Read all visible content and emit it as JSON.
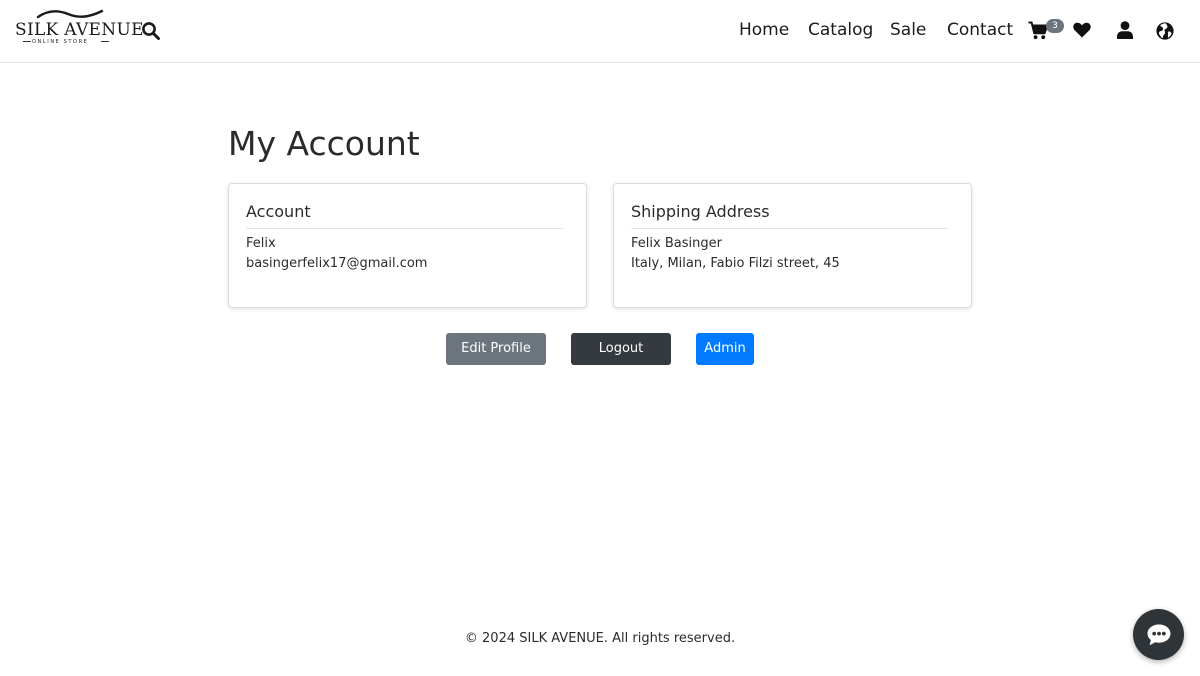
{
  "header": {
    "logo": {
      "brand": "SILK AVENUE",
      "tagline": "ONLINE STORE"
    },
    "search_icon": "search-icon",
    "nav": [
      {
        "label": "Home"
      },
      {
        "label": "Catalog"
      },
      {
        "label": "Sale"
      },
      {
        "label": "Contact"
      }
    ],
    "cart": {
      "icon": "cart-icon",
      "count": "3"
    },
    "wishlist_icon": "heart-icon",
    "account_icon": "user-icon",
    "language_icon": "globe-icon"
  },
  "main": {
    "title": "My Account",
    "account_card": {
      "title": "Account",
      "name": "Felix",
      "email": "basingerfelix17@gmail.com"
    },
    "shipping_card": {
      "title": "Shipping Address",
      "name": "Felix Basinger",
      "address": "Italy, Milan, Fabio Filzi street, 45"
    },
    "buttons": {
      "edit_profile": "Edit Profile",
      "logout": "Logout",
      "admin": "Admin"
    }
  },
  "footer": {
    "copyright": "© 2024 SILK AVENUE. All rights reserved."
  },
  "chat": {
    "icon": "chat-icon"
  },
  "colors": {
    "edit_button": "#6c757d",
    "logout_button": "#343a40",
    "admin_button": "#007bff",
    "cart_badge": "#6c757d"
  }
}
